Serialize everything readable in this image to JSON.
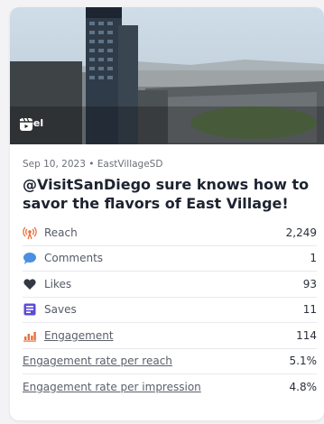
{
  "post": {
    "badge": "Reel",
    "meta": "Sep 10, 2023 • EastVillageSD",
    "title": "@VisitSanDiego sure knows how to savor the flavors of East Village! 😋..."
  },
  "metrics": [
    {
      "label": "Reach",
      "value": "2,249",
      "icon": "reach-icon"
    },
    {
      "label": "Comments",
      "value": "1",
      "icon": "comment-icon"
    },
    {
      "label": "Likes",
      "value": "93",
      "icon": "heart-icon"
    },
    {
      "label": "Saves",
      "value": "11",
      "icon": "save-icon"
    },
    {
      "label": "Engagement",
      "value": "114",
      "icon": "bar-chart-icon"
    },
    {
      "label": "Engagement rate per reach",
      "value": "5.1%"
    },
    {
      "label": "Engagement rate per impression",
      "value": "4.8%"
    }
  ],
  "colors": {
    "reach": "#e8713a",
    "comment": "#4a8fe0",
    "heart": "#333845",
    "save": "#5b4bd6",
    "engagement": "#e8713a"
  }
}
